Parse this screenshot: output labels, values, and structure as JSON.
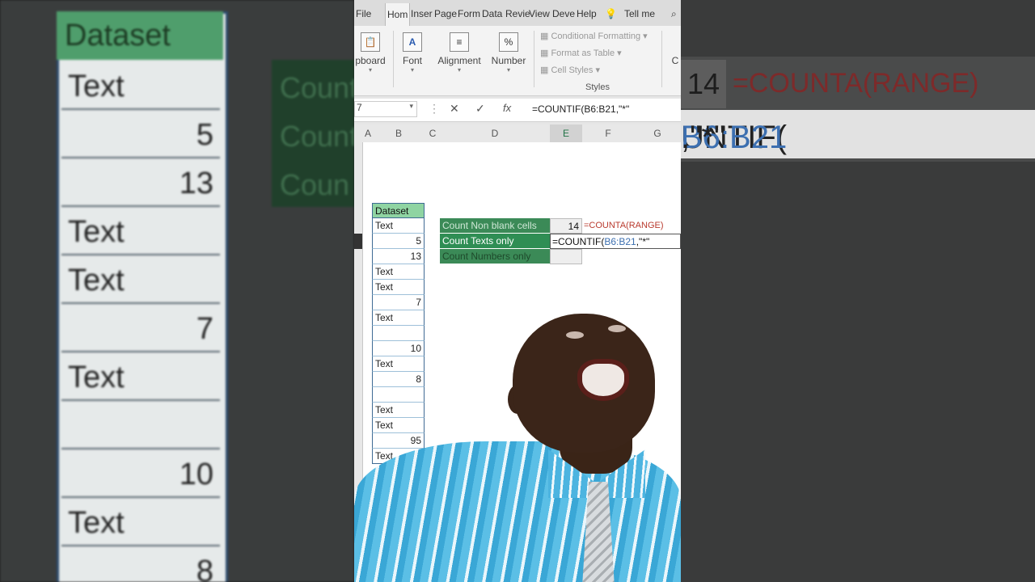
{
  "menu": {
    "items": [
      "File",
      "Hom",
      "Inser",
      "Page",
      "Form",
      "Data",
      "Revie",
      "View",
      "Deve",
      "Help"
    ],
    "active": "Hom",
    "tell_me": "Tell me"
  },
  "ribbon": {
    "clipboard": "pboard",
    "font": "Font",
    "alignment": "Alignment",
    "number": "Number",
    "conditional_formatting": "Conditional Formatting",
    "format_as_table": "Format as Table",
    "cell_styles": "Cell Styles",
    "styles_group": "Styles",
    "cells_partial": "C"
  },
  "formula_bar": {
    "name_box": "7",
    "cancel": "✕",
    "enter": "✓",
    "fx": "fx",
    "formula": "=COUNTIF(B6:B21,\"*\""
  },
  "columns": [
    "A",
    "B",
    "C",
    "D",
    "E",
    "F",
    "G"
  ],
  "selected_column": "E",
  "dataset": {
    "header": "Dataset",
    "cells": [
      {
        "v": "Text",
        "num": false
      },
      {
        "v": "5",
        "num": true
      },
      {
        "v": "13",
        "num": true
      },
      {
        "v": "Text",
        "num": false
      },
      {
        "v": "Text",
        "num": false
      },
      {
        "v": "7",
        "num": true
      },
      {
        "v": "Text",
        "num": false
      },
      {
        "v": "",
        "num": false
      },
      {
        "v": "10",
        "num": true
      },
      {
        "v": "Text",
        "num": false
      },
      {
        "v": "8",
        "num": true
      },
      {
        "v": "",
        "num": false
      },
      {
        "v": "Text",
        "num": false
      },
      {
        "v": "Text",
        "num": false
      },
      {
        "v": "95",
        "num": true
      },
      {
        "v": "Text",
        "num": false
      }
    ]
  },
  "summary": {
    "non_blank_label": "Count Non blank cells",
    "non_blank_value": "14",
    "non_blank_formula": "=COUNTA(RANGE)",
    "texts_label": "Count Texts only",
    "texts_formula_prefix": "=COUNTIF(",
    "texts_formula_ref": "B6:B21",
    "texts_formula_suffix": ",\"*\"",
    "numbers_label": "Count Numbers only"
  },
  "background_zoom": {
    "header": "Dataset",
    "cells": [
      "Text",
      "5",
      "13",
      "Text",
      "Text",
      "7",
      "Text",
      "",
      "10",
      "Text",
      "8"
    ],
    "mid_labels": [
      "Count",
      "Count",
      "Coun"
    ],
    "right_value": "14",
    "right_formula1": "=COUNTA(RANGE)",
    "right_formula2_prefix": "UNTIF(",
    "right_formula2_ref": "B6:B21",
    "right_formula2_suffix": ",\"*\""
  },
  "colors": {
    "excel_green": "#217346",
    "label_green": "#3b8a57",
    "header_green": "#8fd4a2",
    "formula_red": "#b93a2e",
    "ref_blue": "#3c6fb0"
  }
}
